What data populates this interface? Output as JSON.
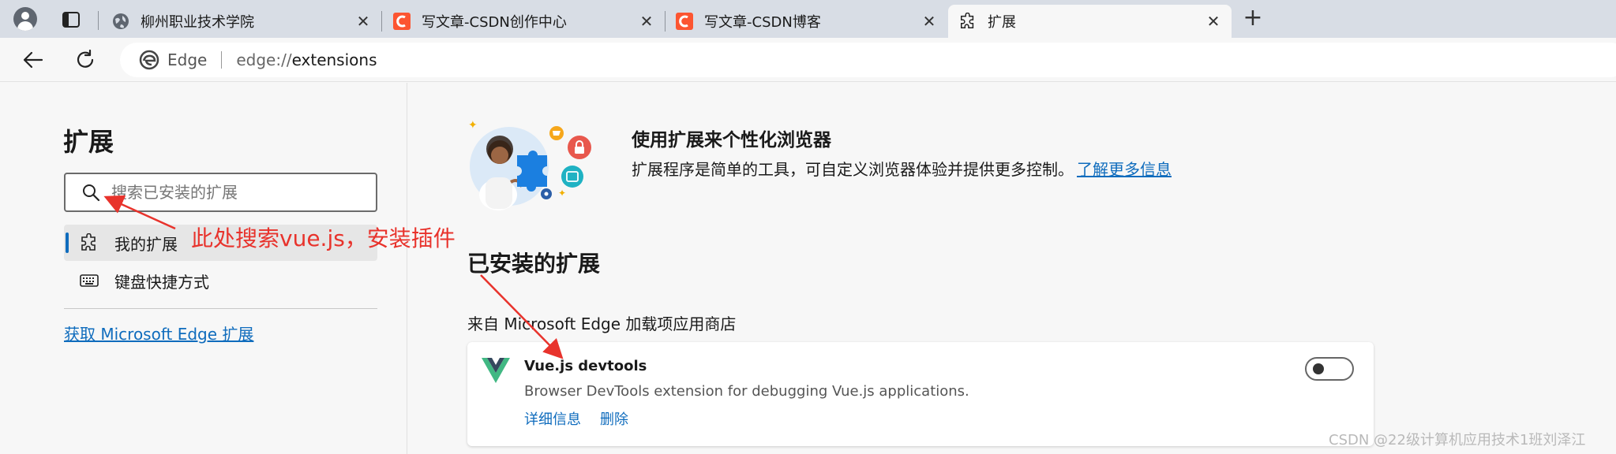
{
  "tabs": [
    {
      "title": "柳州职业技术学院",
      "favicon": "globe-icon"
    },
    {
      "title": "写文章-CSDN创作中心",
      "favicon": "csdn-icon"
    },
    {
      "title": "写文章-CSDN博客",
      "favicon": "csdn-icon"
    },
    {
      "title": "扩展",
      "favicon": "puzzle-icon",
      "active": true
    }
  ],
  "tab_close_glyph": "✕",
  "new_tab_glyph": "+",
  "address": {
    "brand": "Edge",
    "url_prefix": "edge://",
    "url_path": "extensions"
  },
  "sidebar": {
    "title": "扩展",
    "search_placeholder": "搜索已安装的扩展",
    "items": [
      {
        "label": "我的扩展",
        "icon": "puzzle-icon",
        "active": true
      },
      {
        "label": "键盘快捷方式",
        "icon": "keyboard-icon"
      }
    ],
    "store_link": "获取 Microsoft Edge 扩展"
  },
  "hero": {
    "title": "使用扩展来个性化浏览器",
    "description": "扩展程序是简单的工具，可自定义浏览器体验并提供更多控制。",
    "learn_more": "了解更多信息"
  },
  "installed": {
    "heading": "已安装的扩展",
    "source": "来自 Microsoft Edge 加载项应用商店",
    "extensions": [
      {
        "name": "Vue.js devtools",
        "description": "Browser DevTools extension for debugging Vue.js applications.",
        "details_label": "详细信息",
        "remove_label": "删除",
        "enabled": false
      }
    ]
  },
  "annotation": {
    "text": "此处搜索vue.js，安装插件",
    "color": "#e8332c"
  },
  "watermark": "CSDN @22级计算机应用技术1班刘泽江",
  "colors": {
    "accent": "#0f6cbd",
    "csdn": "#fc5531",
    "vue_green": "#41b883",
    "vue_dark": "#35495e"
  }
}
